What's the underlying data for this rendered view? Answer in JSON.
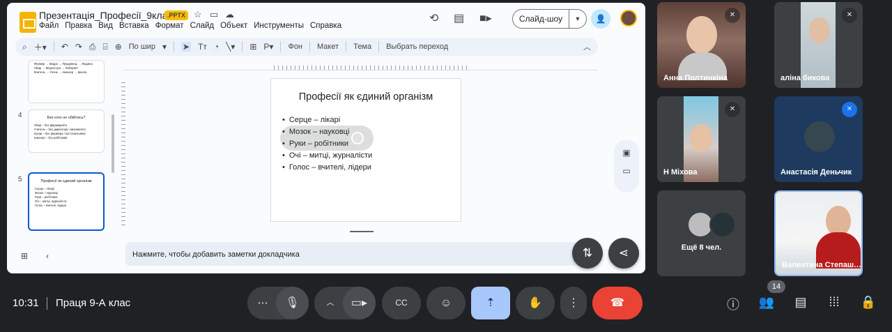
{
  "presentation": {
    "doc_title": "Презентація_Професії_9клас",
    "file_badge": ".PPTX",
    "menu": [
      "Файл",
      "Правка",
      "Вид",
      "Вставка",
      "Формат",
      "Слайд",
      "Объект",
      "Инструменты",
      "Справка"
    ],
    "slideshow_label": "Слайд-шоу",
    "toolbar": {
      "zoom": "По шир",
      "background": "Фон",
      "layout": "Макет",
      "theme": "Тема",
      "transition": "Выбрать переход"
    },
    "filmstrip": [
      {
        "number": "",
        "title": "",
        "bullets": [
          "Фермер → Ведро → Продавець → Людина",
          "Лікар → Медсестра → Лаборант",
          "Вчитель → Учень → Інженер → Школа"
        ]
      },
      {
        "number": "4",
        "title": "Без кого не обійтись?",
        "bullets": [
          "Лікар – без фармацевта",
          "Учитель – без директора і вихователя",
          "Кухар – без фермера і постачальника",
          "Інженер – без робітників"
        ]
      },
      {
        "number": "5",
        "title": "Професії як єдиний організм",
        "bullets": [
          "Серце – лікарі",
          "Мозок – науковці",
          "Руки – робітники",
          "Очі – митці, журналісти",
          "Голос – вчителі, лідери"
        ]
      }
    ],
    "slide": {
      "title": "Професії як єдиний організм",
      "bullets": [
        "Серце – лікарі",
        "Мозок – науковці",
        "Руки – робітники",
        "Очі – митці, журналісти",
        "Голос – вчителі, лідери"
      ]
    },
    "notes_placeholder": "Нажмите, чтобы добавить заметки докладчика"
  },
  "participants": [
    {
      "name": "Анна Полтинкіна",
      "muted": true
    },
    {
      "name": "аліна бикова",
      "muted": true
    },
    {
      "name": "Н Міхова",
      "muted": true
    },
    {
      "name": "Анастасія Деньчик",
      "muted": true
    },
    {
      "name": "Валентина Степаш…",
      "muted": false
    }
  ],
  "more_participants": "Ещё 8 чел.",
  "meeting": {
    "time": "10:31",
    "title": "Праця 9-А клас",
    "people_count": "14"
  },
  "colors": {
    "background": "#202124",
    "tile": "#3c4043",
    "present_button": "#a8c7fa",
    "leave_button": "#ea4335",
    "slides_brand": "#f4b400"
  }
}
